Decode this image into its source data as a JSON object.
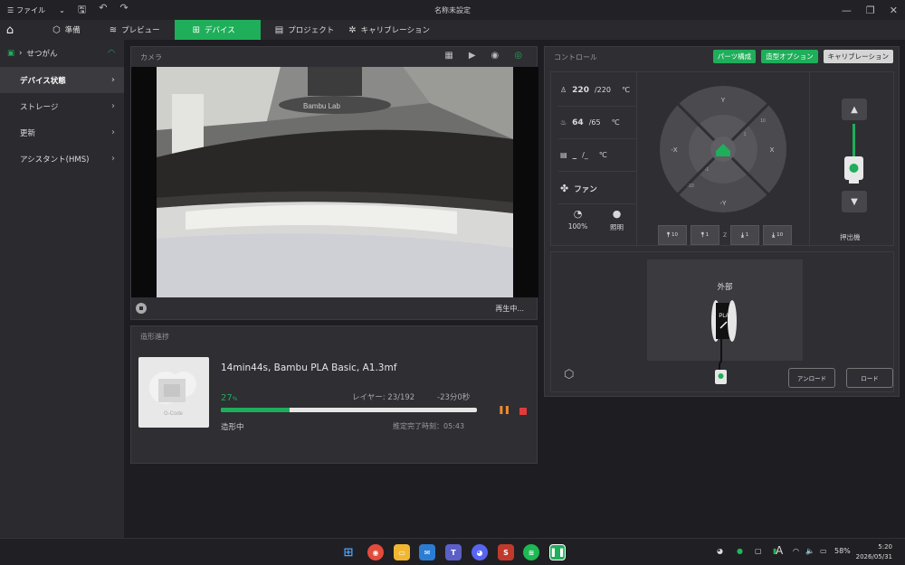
{
  "titlebar": {
    "menu_label": "ファイル",
    "window_title": "名称未設定"
  },
  "tabs": [
    {
      "label": "準備",
      "icon": "cube-icon"
    },
    {
      "label": "プレビュー",
      "icon": "layers-icon"
    },
    {
      "label": "デバイス",
      "icon": "device-icon",
      "active": true
    },
    {
      "label": "プロジェクト",
      "icon": "project-icon"
    },
    {
      "label": "キャリブレーション",
      "icon": "calibration-icon"
    }
  ],
  "sidebar": {
    "device_name": "せつがん",
    "items": [
      {
        "label": "デバイス状態",
        "active": true
      },
      {
        "label": "ストレージ"
      },
      {
        "label": "更新"
      },
      {
        "label": "アシスタント(HMS)"
      }
    ]
  },
  "camera": {
    "title": "カメラ",
    "status": "再生中...",
    "feed_label": "Bambu Lab"
  },
  "progress": {
    "title": "造形進捗",
    "file": "14min44s, Bambu PLA Basic, A1.3mf",
    "percent": 27,
    "percent_text": "27",
    "percent_sign": "%",
    "layer": "レイヤー: 23/192",
    "remaining": "-23分0秒",
    "status": "造形中",
    "eta": "推定完了時刻：05:43",
    "thumb_label": "G-Code"
  },
  "control": {
    "title": "コントロール",
    "buttons": [
      "パーツ構成",
      "造型オプション",
      "キャリブレーション"
    ],
    "nozzle": {
      "current": "220",
      "target": "/220",
      "unit": "℃"
    },
    "bed": {
      "current": "64",
      "target": "/65",
      "unit": "℃"
    },
    "chamber": {
      "current": "_",
      "target": "/_",
      "unit": "℃"
    },
    "fan_label": "ファン",
    "speed": "100%",
    "light": "照明",
    "jog": {
      "y": "Y",
      "x": "X",
      "nx": "-X",
      "ny": "-Y",
      "p10": "10",
      "p1": "1",
      "n1": "-1",
      "n10": "-10"
    },
    "z_buttons": [
      "10",
      "1",
      "1",
      "10"
    ],
    "z_label": "Z",
    "extruder_label": "押出機"
  },
  "ams": {
    "external": "外部",
    "filament": "PLA",
    "unload": "アンロード",
    "load": "ロード"
  },
  "taskbar": {
    "time": "5:20",
    "date": "2026/05/31",
    "battery": "58%",
    "ime": "A"
  }
}
